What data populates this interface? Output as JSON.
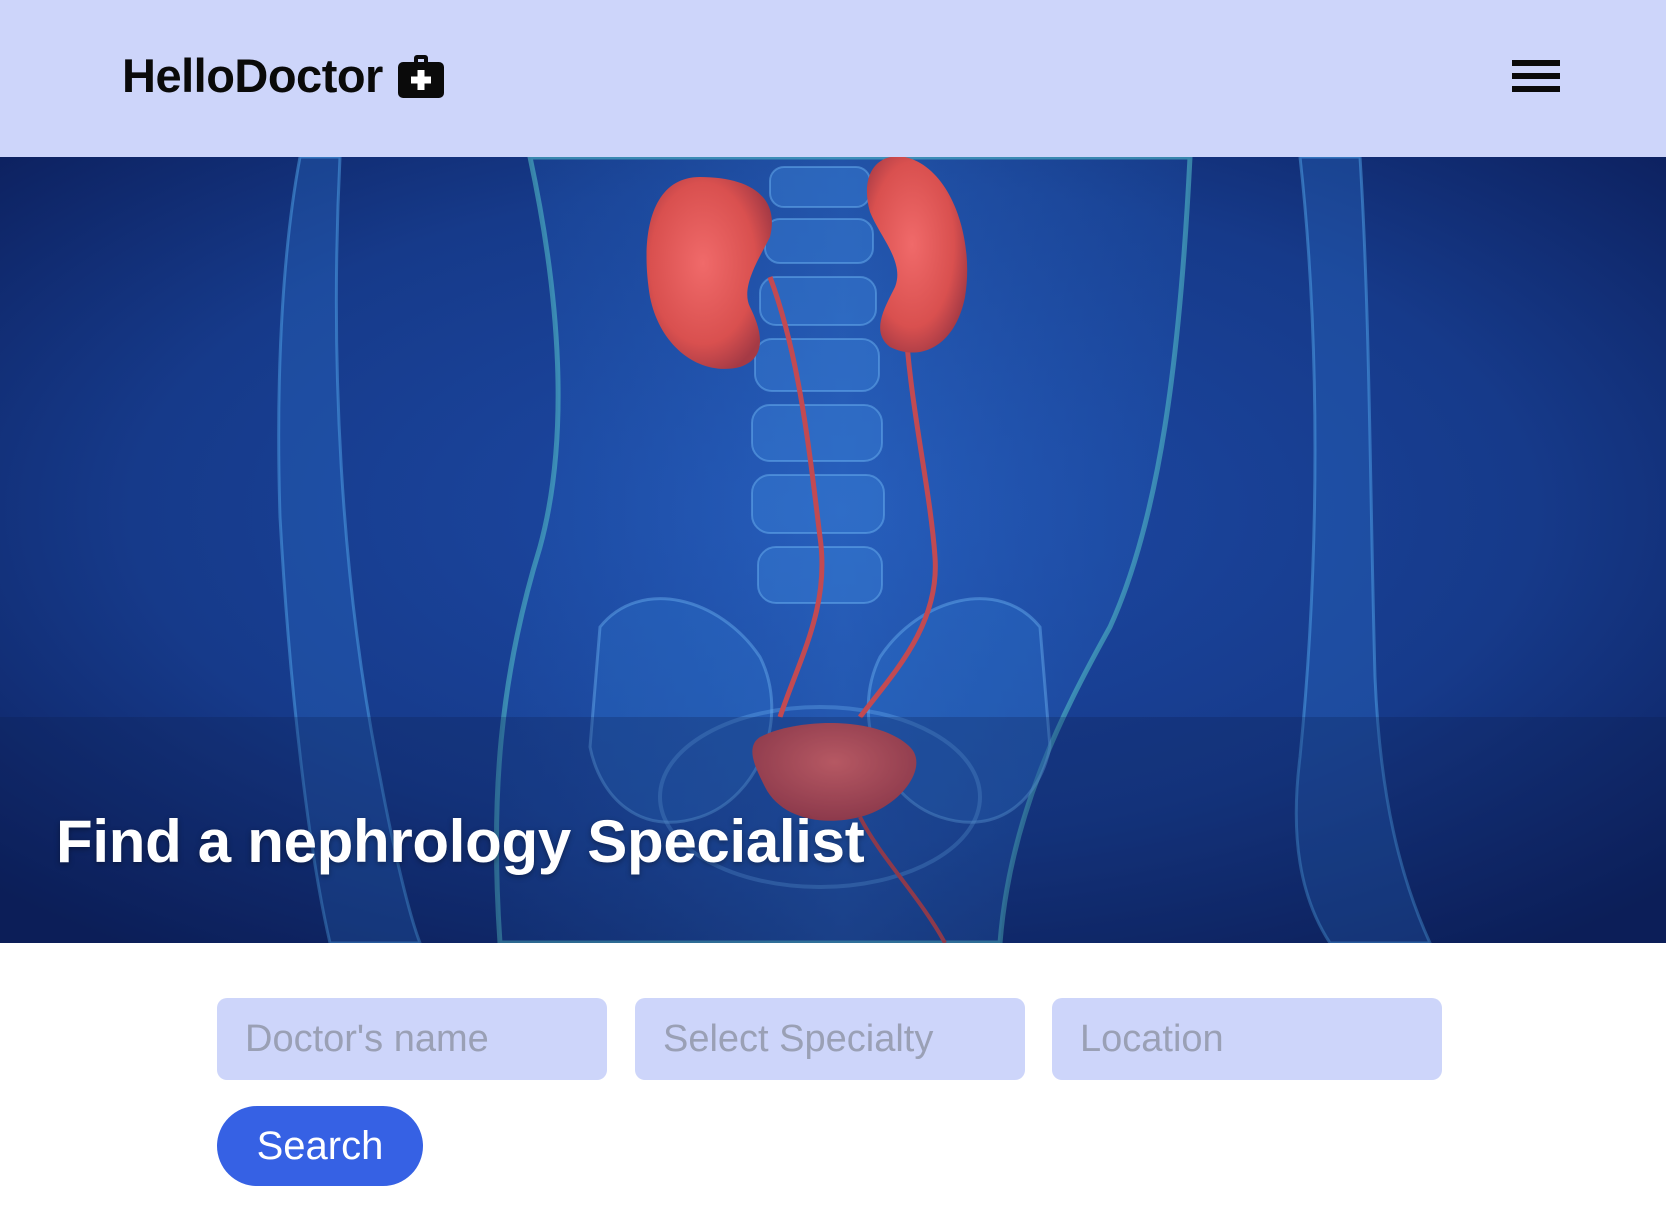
{
  "navbar": {
    "brand_name": "HelloDoctor",
    "brand_icon": "medical-kit-icon",
    "menu_icon": "hamburger-menu-icon"
  },
  "hero": {
    "title": "Find a nephrology Specialist",
    "image_subject": "kidney-urinary-system-illustration"
  },
  "search": {
    "doctor_name_placeholder": "Doctor's name",
    "specialty_placeholder": "Select Specialty",
    "location_placeholder": "Location",
    "button_label": "Search"
  },
  "colors": {
    "navbar_bg": "#cdd5fa",
    "field_bg": "#cdd5fa",
    "button_bg": "#3661e4",
    "hero_bg": "#10256a"
  }
}
